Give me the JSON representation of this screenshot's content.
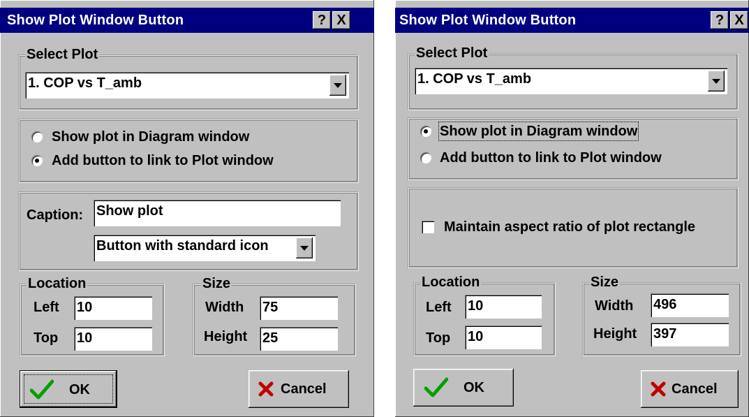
{
  "dialog_left": {
    "title": "Show Plot Window Button",
    "help_glyph": "?",
    "close_glyph": "X",
    "select_plot": {
      "legend": "Select Plot",
      "value": "1. COP vs T_amb"
    },
    "display_mode": {
      "options": [
        {
          "label": "Show plot in Diagram window",
          "selected": false
        },
        {
          "label": "Add button to link to Plot window",
          "selected": true
        }
      ]
    },
    "caption": {
      "label": "Caption:",
      "value": "Show plot"
    },
    "button_style": {
      "value": "Button with standard icon"
    },
    "location": {
      "legend": "Location",
      "left_label": "Left",
      "left_value": "10",
      "top_label": "Top",
      "top_value": "10"
    },
    "size": {
      "legend": "Size",
      "width_label": "Width",
      "width_value": "75",
      "height_label": "Height",
      "height_value": "25"
    },
    "ok_label": "OK",
    "cancel_label": "Cancel"
  },
  "dialog_right": {
    "title": "Show Plot Window Button",
    "help_glyph": "?",
    "close_glyph": "X",
    "select_plot": {
      "legend": "Select Plot",
      "value": "1. COP vs T_amb"
    },
    "display_mode": {
      "options": [
        {
          "label": "Show plot in Diagram window",
          "selected": true
        },
        {
          "label": "Add button to link to Plot window",
          "selected": false
        }
      ]
    },
    "aspect": {
      "label": "Maintain aspect ratio of plot rectangle",
      "checked": false
    },
    "location": {
      "legend": "Location",
      "left_label": "Left",
      "left_value": "10",
      "top_label": "Top",
      "top_value": "10"
    },
    "size": {
      "legend": "Size",
      "width_label": "Width",
      "width_value": "496",
      "height_label": "Height",
      "height_value": "397"
    },
    "ok_label": "OK",
    "cancel_label": "Cancel"
  },
  "colors": {
    "title_bar": "#000080",
    "face": "#c0c0c0",
    "check_mark": "#00a000",
    "cancel_x": "#c00000"
  },
  "icons": {
    "ok": "green-check-icon",
    "cancel": "red-x-icon"
  }
}
